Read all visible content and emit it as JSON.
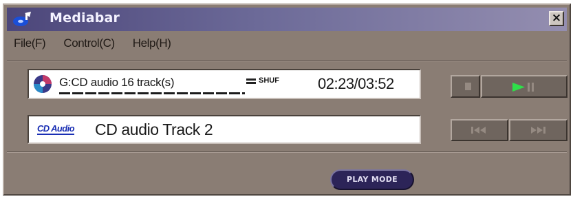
{
  "window": {
    "title": "Mediabar",
    "close_glyph": "×"
  },
  "menu": {
    "items": [
      {
        "label": "File(F)"
      },
      {
        "label": "Control(C)"
      },
      {
        "label": "Help(H)"
      }
    ]
  },
  "now_playing": {
    "source": "G:CD audio 16 track(s)",
    "play_mode": "SHUF",
    "time": "02:23/03:52",
    "track_badge": "CD Audio",
    "track_title": "CD audio Track 2"
  },
  "controls": {
    "playmode_label": "PLAY MODE"
  },
  "colors": {
    "title_gradient_start": "#4c467a",
    "play_icon": "#2ee04a",
    "body": "#8a7d74"
  },
  "icons": [
    "app-icon",
    "cd-icon",
    "shuffle-icon",
    "stop-icon",
    "play-icon",
    "pause-icon",
    "previous-icon",
    "next-icon",
    "close-icon"
  ]
}
